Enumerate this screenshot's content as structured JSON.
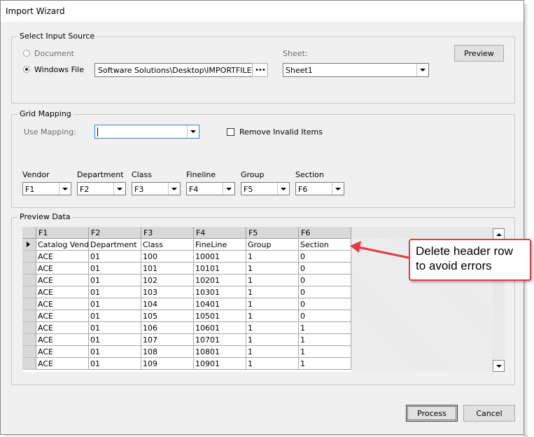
{
  "window": {
    "title": "Import Wizard"
  },
  "input_source": {
    "legend": "Select Input Source",
    "radio_document": "Document",
    "radio_windows_file": "Windows File",
    "selected": "Windows File",
    "file_path": "Software Solutions\\Desktop\\IMPORTFILE.xls",
    "browse_label": "•••",
    "sheet_label": "Sheet:",
    "sheet_value": "Sheet1",
    "preview_button": "Preview"
  },
  "grid_mapping": {
    "legend": "Grid Mapping",
    "use_mapping_label": "Use Mapping:",
    "use_mapping_value": "",
    "remove_invalid_label": "Remove Invalid Items",
    "remove_invalid_checked": false,
    "fields": [
      {
        "label": "Vendor",
        "value": "F1"
      },
      {
        "label": "Department",
        "value": "F2"
      },
      {
        "label": "Class",
        "value": "F3"
      },
      {
        "label": "Fineline",
        "value": "F4"
      },
      {
        "label": "Group",
        "value": "F5"
      },
      {
        "label": "Section",
        "value": "F6"
      }
    ]
  },
  "preview": {
    "legend": "Preview Data",
    "columns": [
      "F1",
      "F2",
      "F3",
      "F4",
      "F5",
      "F6"
    ],
    "rows": [
      [
        "Catalog Vend",
        "Department",
        "Class",
        "FineLine",
        "Group",
        "Section"
      ],
      [
        "ACE",
        "01",
        "100",
        "10001",
        "1",
        "0"
      ],
      [
        "ACE",
        "01",
        "101",
        "10101",
        "1",
        "0"
      ],
      [
        "ACE",
        "01",
        "102",
        "10201",
        "1",
        "0"
      ],
      [
        "ACE",
        "01",
        "103",
        "10301",
        "1",
        "0"
      ],
      [
        "ACE",
        "01",
        "104",
        "10401",
        "1",
        "0"
      ],
      [
        "ACE",
        "01",
        "105",
        "10501",
        "1",
        "0"
      ],
      [
        "ACE",
        "01",
        "106",
        "10601",
        "1",
        "1"
      ],
      [
        "ACE",
        "01",
        "107",
        "10701",
        "1",
        "1"
      ],
      [
        "ACE",
        "01",
        "108",
        "10801",
        "1",
        "1"
      ],
      [
        "ACE",
        "01",
        "109",
        "10901",
        "1",
        "1"
      ]
    ],
    "current_row": 0
  },
  "callout": {
    "text": "Delete header row to avoid errors",
    "color": "#e53a44"
  },
  "footer": {
    "process_button": "Process",
    "cancel_button": "Cancel"
  }
}
